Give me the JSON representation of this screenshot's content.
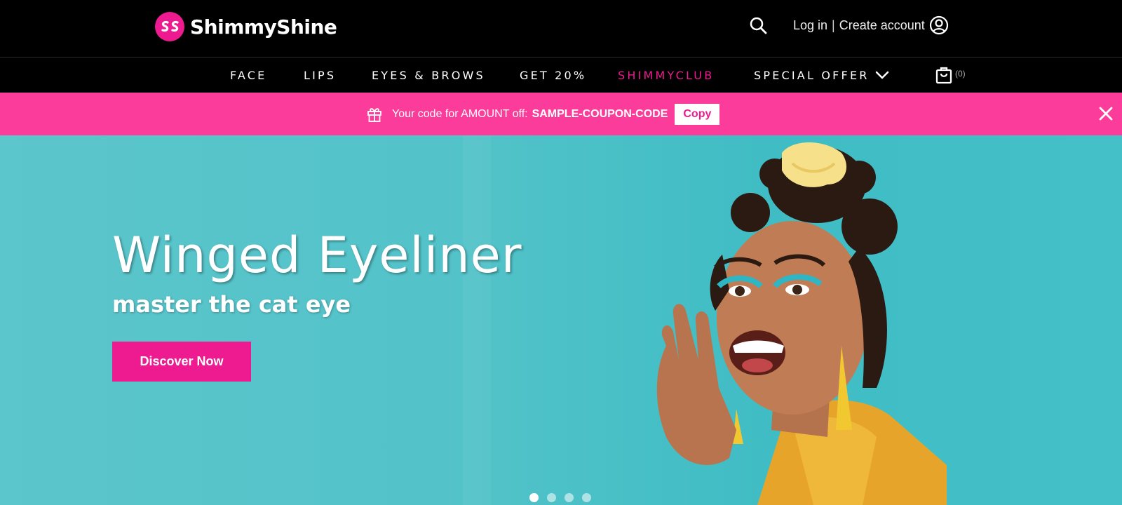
{
  "brand": {
    "name": "ShimmyShine",
    "accent": "#ee1a8f",
    "promo_bg": "#fb3c9b"
  },
  "header": {
    "login_label": "Log in",
    "separator": "|",
    "create_account_label": "Create account",
    "icons": [
      "search-icon",
      "user-icon"
    ]
  },
  "nav": {
    "items": [
      {
        "label": "FACE"
      },
      {
        "label": "LIPS"
      },
      {
        "label": "EYES & BROWS"
      },
      {
        "label": "GET 20%"
      },
      {
        "label": "SHIMMYCLUB"
      },
      {
        "label": "SPECIAL OFFER"
      }
    ],
    "cart_count": "(0)"
  },
  "promo": {
    "text": "Your code for AMOUNT off:",
    "code": "SAMPLE-COUPON-CODE",
    "copy_label": "Copy"
  },
  "hero": {
    "title": "Winged Eyeliner",
    "subtitle": "master the cat eye",
    "cta_label": "Discover Now",
    "slide_count": 4,
    "active_slide": 1
  }
}
